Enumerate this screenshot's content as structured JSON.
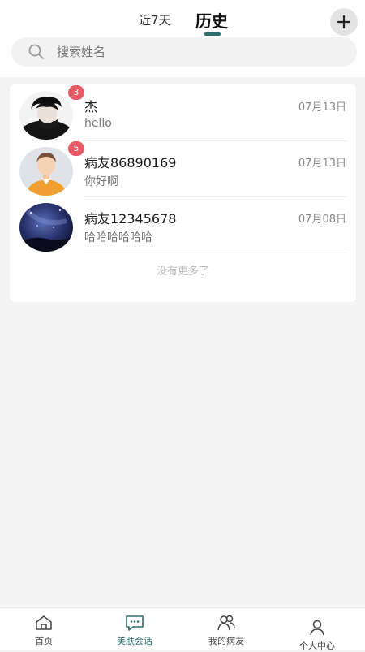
{
  "header": {
    "tabs": [
      {
        "label": "近7天",
        "active": false
      },
      {
        "label": "历史",
        "active": true
      }
    ],
    "add_icon": "plus-icon"
  },
  "search": {
    "placeholder": "搜索姓名",
    "value": "",
    "icon": "search-icon"
  },
  "conversations": [
    {
      "name": "杰",
      "date": "07月13日",
      "message": "hello",
      "badge": "3",
      "avatar": "photo-boy"
    },
    {
      "name": "病友86890169",
      "date": "07月13日",
      "message": "你好啊",
      "badge": "5",
      "avatar": "default-person"
    },
    {
      "name": "病友12345678",
      "date": "07月08日",
      "message": "哈哈哈哈哈哈",
      "badge": "",
      "avatar": "photo-night-sky"
    }
  ],
  "list_footer": "没有更多了",
  "bottom_nav": [
    {
      "label": "首页",
      "icon": "home-icon",
      "active": false
    },
    {
      "label": "美肤会话",
      "icon": "chat-icon",
      "active": true
    },
    {
      "label": "我的病友",
      "icon": "friends-icon",
      "active": false
    },
    {
      "label": "个人中心",
      "icon": "person-icon",
      "active": false
    }
  ],
  "colors": {
    "accent": "#2d6f6d",
    "badge": "#e85a66",
    "background": "#f4f4f4"
  }
}
